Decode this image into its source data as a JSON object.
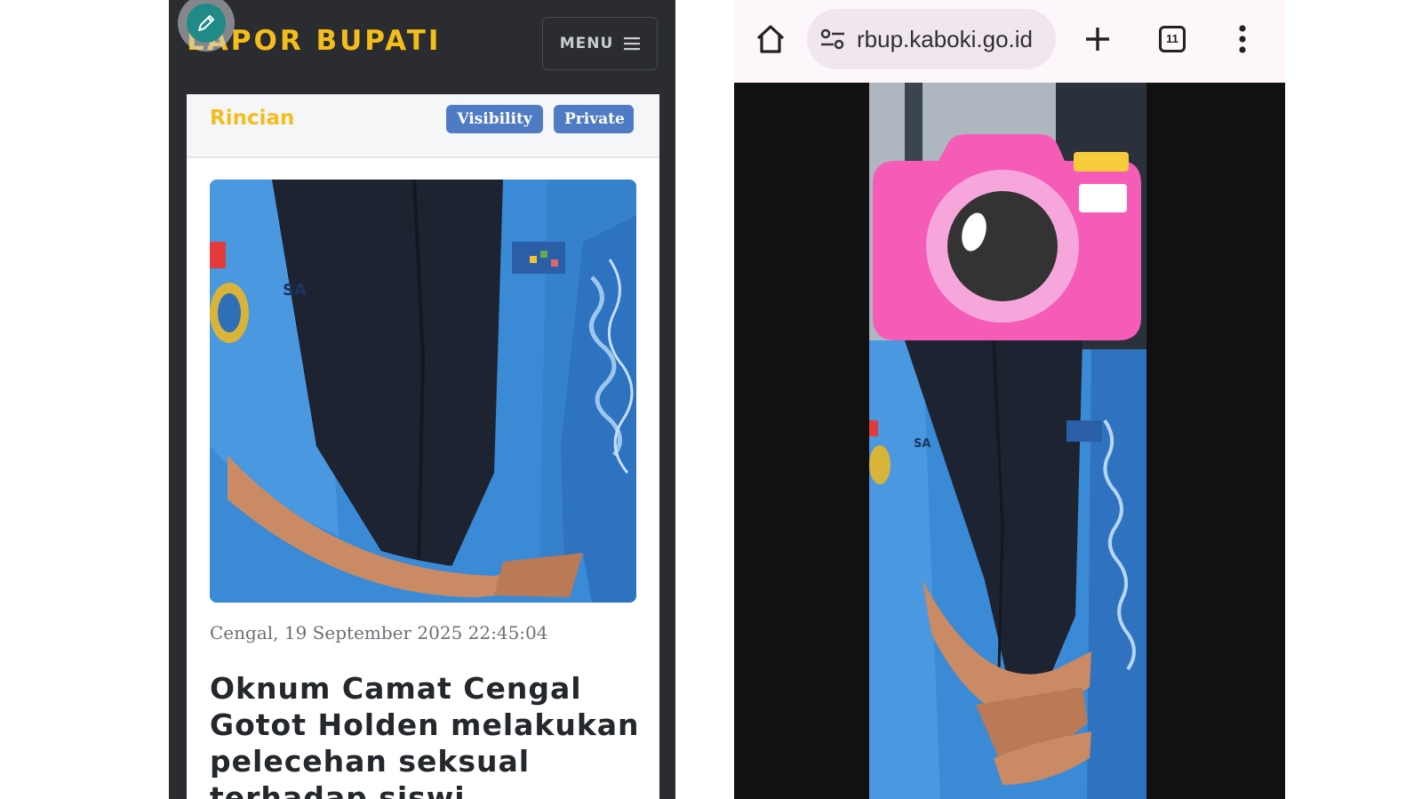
{
  "left_screen": {
    "site_title": "LAPOR BUPATI",
    "menu_label": "MENU",
    "card": {
      "section_title": "Rincian",
      "badges": [
        "Visibility",
        "Private"
      ],
      "date_line": "Cengal, 19 September 2025 22:45:04",
      "headline": "Oknum Camat Cengal Gotot Holden melakukan pelecehan seksual terhadap siswi"
    },
    "icons": [
      "edit-icon",
      "hamburger-icon"
    ],
    "colors": {
      "brand_yellow": "#f3bd1c",
      "badge_blue": "#4f7bc4",
      "header_dark": "#2a2c30"
    }
  },
  "right_screen": {
    "browser": {
      "url_text": "rbup.kaboki.go.id",
      "tab_count": "11"
    },
    "icons": [
      "home-icon",
      "site-settings-icon",
      "new-tab-plus-icon",
      "tab-switcher-icon",
      "more-options-icon",
      "camera-sticker-icon"
    ],
    "colors": {
      "sticker_pink": "#f55cb8",
      "toolbar_bg": "#fdf6fb"
    }
  }
}
